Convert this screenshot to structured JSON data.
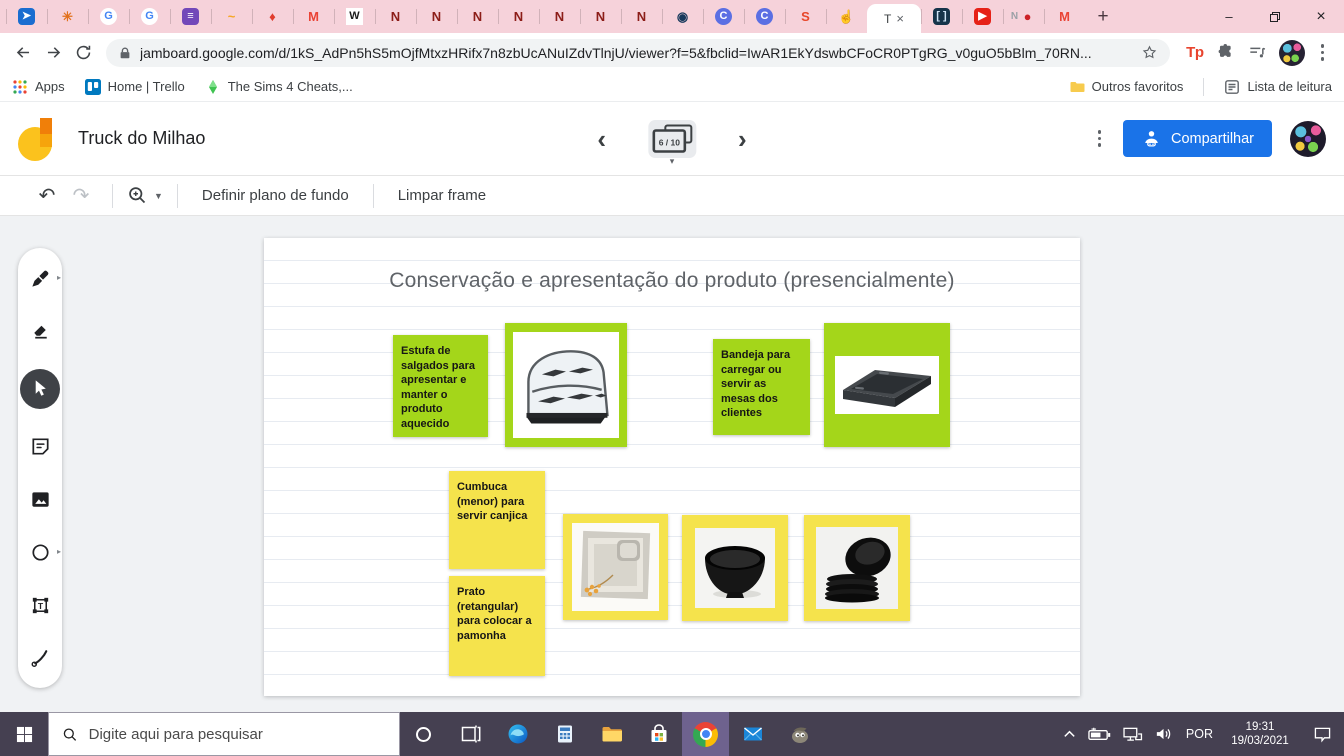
{
  "colors": {
    "accent_blue": "#1a73e8",
    "note_green": "#a4d61a",
    "note_yellow": "#f5e34c",
    "tabstrip_pink": "#f6d2da",
    "taskbar_purple": "#454051",
    "taskbar_active_app": "#6e628e"
  },
  "browser": {
    "tab_strip": {
      "pinned_tabs": [
        {
          "name": "send-tab",
          "icon": "send-icon",
          "glyph": "➤",
          "fg": "#ffffff",
          "bg": "#1a6dd0",
          "shape": "rounded"
        },
        {
          "name": "gear-tab",
          "icon": "gear-icon",
          "glyph": "✳",
          "fg": "#e2711d",
          "bg": "",
          "shape": ""
        },
        {
          "name": "google-tab-1",
          "icon": "google-g-icon",
          "glyph": "G",
          "fg": "#4285f4",
          "bg": "#ffffff",
          "shape": "circle"
        },
        {
          "name": "google-tab-2",
          "icon": "google-g-icon",
          "glyph": "G",
          "fg": "#4285f4",
          "bg": "#ffffff",
          "shape": "circle"
        },
        {
          "name": "forms-tab",
          "icon": "forms-list-icon",
          "glyph": "≡",
          "fg": "#ffffff",
          "bg": "#7248b9",
          "shape": "rounded"
        },
        {
          "name": "wave-tab",
          "icon": "wave-icon",
          "glyph": "~",
          "fg": "#f5a623",
          "bg": "",
          "shape": ""
        },
        {
          "name": "drop-tab",
          "icon": "red-drop-icon",
          "glyph": "♦",
          "fg": "#e03d2e",
          "bg": "",
          "shape": ""
        },
        {
          "name": "gmail-tab-1",
          "icon": "gmail-m-icon",
          "glyph": "M",
          "fg": "#ea4335",
          "bg": "",
          "shape": ""
        },
        {
          "name": "wikipedia-tab",
          "icon": "wikipedia-w-icon",
          "glyph": "W",
          "fg": "#1b1b1b",
          "bg": "#ffffff",
          "shape": ""
        },
        {
          "name": "red-logo-tab-1",
          "icon": "red-creature-icon",
          "glyph": "N",
          "fg": "#8c1d18",
          "bg": "",
          "shape": ""
        },
        {
          "name": "red-logo-tab-2",
          "icon": "red-creature-icon",
          "glyph": "N",
          "fg": "#8c1d18",
          "bg": "",
          "shape": ""
        },
        {
          "name": "red-logo-tab-3",
          "icon": "red-creature-icon",
          "glyph": "N",
          "fg": "#8c1d18",
          "bg": "",
          "shape": ""
        },
        {
          "name": "red-logo-tab-4",
          "icon": "red-creature-icon",
          "glyph": "N",
          "fg": "#8c1d18",
          "bg": "",
          "shape": ""
        },
        {
          "name": "red-logo-tab-5",
          "icon": "red-creature-icon",
          "glyph": "N",
          "fg": "#8c1d18",
          "bg": "",
          "shape": ""
        },
        {
          "name": "red-logo-tab-6",
          "icon": "red-creature-icon",
          "glyph": "N",
          "fg": "#8c1d18",
          "bg": "",
          "shape": ""
        },
        {
          "name": "red-logo-tab-7",
          "icon": "red-creature-icon",
          "glyph": "N",
          "fg": "#8c1d18",
          "bg": "",
          "shape": ""
        },
        {
          "name": "dark-badge-tab",
          "icon": "dark-circle-icon",
          "glyph": "◉",
          "fg": "#17395c",
          "bg": "",
          "shape": ""
        },
        {
          "name": "c-blue-tab-1",
          "icon": "c-circle-icon",
          "glyph": "C",
          "fg": "#ffffff",
          "bg": "#5b6fe3",
          "shape": "circle"
        },
        {
          "name": "c-blue-tab-2",
          "icon": "c-circle-icon",
          "glyph": "C",
          "fg": "#ffffff",
          "bg": "#5b6fe3",
          "shape": "circle"
        },
        {
          "name": "s-tab",
          "icon": "s-letter-icon",
          "glyph": "S",
          "fg": "#e8472b",
          "bg": "",
          "shape": ""
        },
        {
          "name": "hand-tab",
          "icon": "yellow-hand-icon",
          "glyph": "☝",
          "fg": "#f0a93c",
          "bg": "",
          "shape": ""
        }
      ],
      "active_tab": {
        "name": "jamboard-tab",
        "label": "T",
        "close_glyph": "×"
      },
      "tabs_after_active": [
        {
          "name": "brackets-tab",
          "icon": "brackets-icon",
          "glyph": "[ ]",
          "fg": "#cfe3f5",
          "bg": "#16344a",
          "shape": "rounded"
        },
        {
          "name": "youtube-tab",
          "icon": "youtube-play-icon",
          "glyph": "▶",
          "fg": "#ffffff",
          "bg": "#e62117",
          "shape": "rounded"
        },
        {
          "name": "record-tab",
          "icon": "record-dot-icon",
          "glyph": "●",
          "fg": "#cc2127",
          "bg": "",
          "shape": "",
          "prefix": "N"
        },
        {
          "name": "gmail-tab-2",
          "icon": "gmail-m-icon",
          "glyph": "M",
          "fg": "#ea4335",
          "bg": "",
          "shape": ""
        }
      ],
      "new_tab_glyph": "+",
      "window": {
        "minimize": "–",
        "close": "×"
      }
    },
    "omnibox": {
      "url": "jamboard.google.com/d/1kS_AdPn5hS5mOjfMtxzHRifx7n8zbUcANuIZdvTlnjU/viewer?f=5&fbclid=IwAR1EkYdswbCFoCR0PTgRG_v0guO5bBlm_70RN...",
      "extension_badge": "Tp"
    },
    "bookmarks_bar": {
      "items": [
        {
          "name": "apps-shortcut",
          "icon": "apps-grid-icon",
          "label": "Apps"
        },
        {
          "name": "trello-bookmark",
          "icon": "trello-icon",
          "label": "Home | Trello"
        },
        {
          "name": "sims-bookmark",
          "icon": "plumbob-icon",
          "label": "The Sims 4 Cheats,..."
        }
      ],
      "right_items": [
        {
          "name": "other-favorites",
          "icon": "folder-icon",
          "label": "Outros favoritos"
        },
        {
          "name": "reading-list",
          "icon": "reading-list-icon",
          "label": "Lista de leitura"
        }
      ]
    }
  },
  "jamboard": {
    "doc_title": "Truck do Milhao",
    "frame_indicator": "6 / 10",
    "share_button": "Compartilhar",
    "toolbar": {
      "set_background_label": "Definir plano de fundo",
      "clear_frame_label": "Limpar frame"
    },
    "tools": [
      {
        "name": "pen-tool",
        "icon": "pen-icon",
        "has_submenu": true,
        "active": false
      },
      {
        "name": "eraser-tool",
        "icon": "eraser-icon",
        "has_submenu": false,
        "active": false
      },
      {
        "name": "select-tool",
        "icon": "cursor-icon",
        "has_submenu": false,
        "active": true
      },
      {
        "name": "sticky-note-tool",
        "icon": "note-icon",
        "has_submenu": false,
        "active": false
      },
      {
        "name": "image-tool",
        "icon": "image-icon",
        "has_submenu": false,
        "active": false
      },
      {
        "name": "shape-tool",
        "icon": "circle-icon",
        "has_submenu": true,
        "active": false
      },
      {
        "name": "textbox-tool",
        "icon": "textbox-icon",
        "has_submenu": false,
        "active": false
      },
      {
        "name": "laser-tool",
        "icon": "laser-icon",
        "has_submenu": false,
        "active": false
      }
    ],
    "canvas": {
      "title": "Conservação e apresentação do produto (presencialmente)",
      "notes": [
        {
          "text": "Estufa de salgados para apresentar e manter o produto aquecido",
          "color": "green"
        },
        {
          "text": "Bandeja para carregar ou servir as mesas dos clientes",
          "color": "green"
        },
        {
          "text": "Cumbuca (menor) para servir canjica",
          "color": "yellow"
        },
        {
          "text": "Prato (retangular) para colocar a pamonha",
          "color": "yellow"
        }
      ],
      "photos": [
        {
          "name": "food-warmer-photo",
          "frame": "green",
          "depicts": "estufa de salgados - curved glass food warmer"
        },
        {
          "name": "serving-tray-photo",
          "frame": "green",
          "depicts": "black serving tray"
        },
        {
          "name": "square-plates-photo",
          "frame": "yellow",
          "depicts": "silver square plates with small bowl and dried flowers"
        },
        {
          "name": "black-bowl-photo",
          "frame": "yellow",
          "depicts": "black bowl (cumbuca)"
        },
        {
          "name": "stacked-bowls-photo",
          "frame": "yellow",
          "depicts": "stack of black bowls"
        }
      ]
    }
  },
  "taskbar": {
    "search_placeholder": "Digite aqui para pesquisar",
    "apps": [
      {
        "name": "task-view-button",
        "icon": "task-view-icon",
        "active": false
      },
      {
        "name": "edge-button",
        "icon": "edge-icon",
        "active": false
      },
      {
        "name": "calculator-button",
        "icon": "calculator-icon",
        "active": false
      },
      {
        "name": "file-explorer-button",
        "icon": "explorer-folder-icon",
        "active": false
      },
      {
        "name": "store-button",
        "icon": "store-bag-icon",
        "active": false
      },
      {
        "name": "chrome-button",
        "icon": "chrome-icon",
        "active": true
      },
      {
        "name": "mail-button",
        "icon": "mail-icon",
        "active": false
      },
      {
        "name": "gimp-button",
        "icon": "gimp-icon",
        "active": false
      }
    ],
    "tray": {
      "language": "POR",
      "time": "19:31",
      "date": "19/03/2021"
    }
  }
}
